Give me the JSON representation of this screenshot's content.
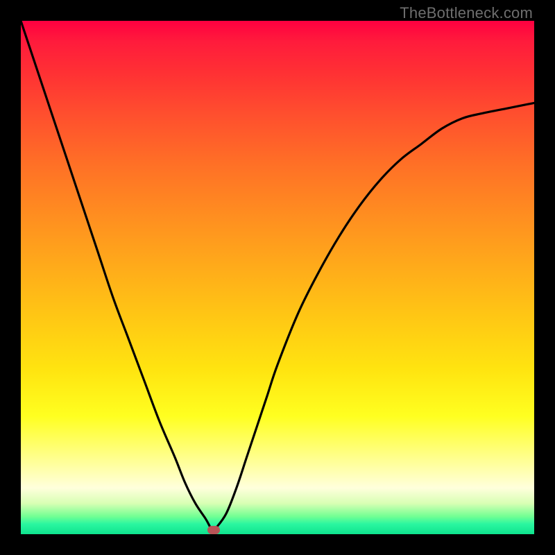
{
  "watermark": "TheBottleneck.com",
  "colors": {
    "frame": "#000000",
    "curve": "#000000",
    "marker": "#b85457"
  },
  "chart_data": {
    "type": "line",
    "title": "",
    "xlabel": "",
    "ylabel": "",
    "xlim": [
      0,
      1
    ],
    "ylim": [
      0,
      1
    ],
    "x": [
      0.0,
      0.03,
      0.06,
      0.09,
      0.12,
      0.15,
      0.18,
      0.21,
      0.24,
      0.27,
      0.3,
      0.32,
      0.34,
      0.36,
      0.37,
      0.375,
      0.38,
      0.4,
      0.42,
      0.44,
      0.46,
      0.48,
      0.5,
      0.54,
      0.58,
      0.62,
      0.66,
      0.7,
      0.74,
      0.78,
      0.82,
      0.86,
      0.9,
      0.95,
      1.0
    ],
    "y": [
      1.0,
      0.91,
      0.82,
      0.73,
      0.64,
      0.55,
      0.46,
      0.38,
      0.3,
      0.22,
      0.15,
      0.1,
      0.06,
      0.03,
      0.012,
      0.008,
      0.012,
      0.04,
      0.09,
      0.15,
      0.21,
      0.27,
      0.33,
      0.43,
      0.51,
      0.58,
      0.64,
      0.69,
      0.73,
      0.76,
      0.79,
      0.81,
      0.82,
      0.83,
      0.84
    ],
    "marker": {
      "x": 0.375,
      "y": 0.008
    },
    "annotations": []
  }
}
